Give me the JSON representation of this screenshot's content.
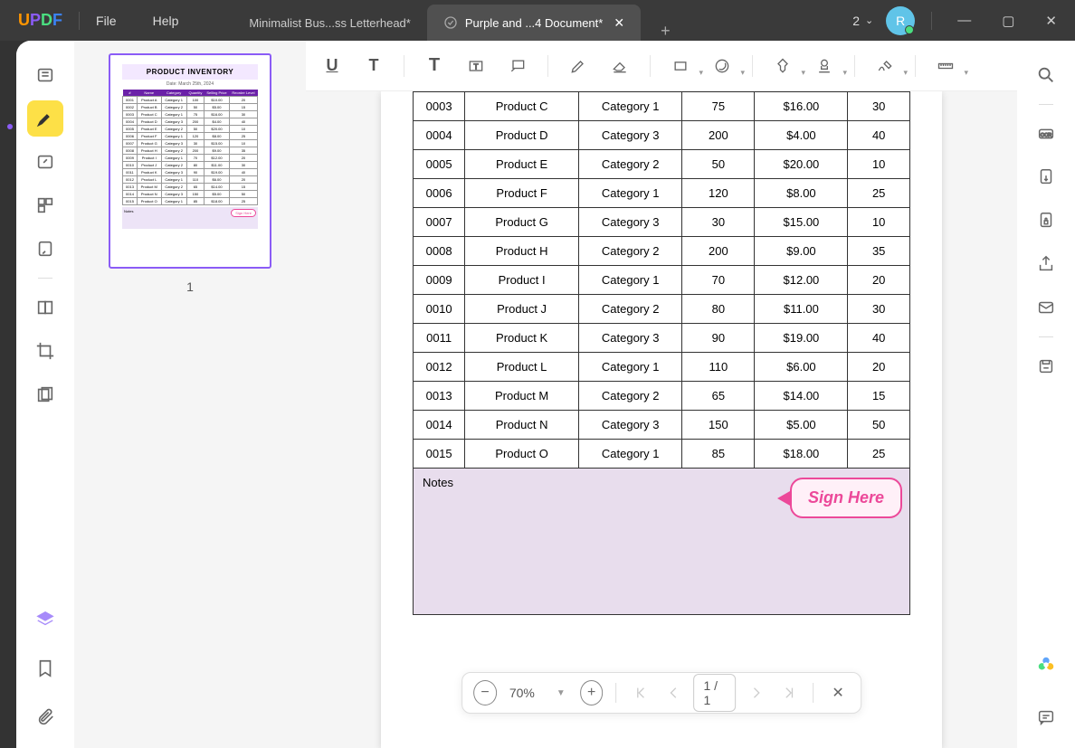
{
  "app": {
    "logo": "UPDF"
  },
  "menus": {
    "file": "File",
    "help": "Help"
  },
  "tabs": [
    {
      "label": "Minimalist Bus...ss Letterhead*",
      "active": false
    },
    {
      "label": "Purple and ...4 Document*",
      "active": true
    }
  ],
  "titlebar": {
    "notif_count": "2",
    "avatar_initial": "R"
  },
  "thumbnail": {
    "title": "PRODUCT INVENTORY",
    "date": "Date: March 25th, 2024",
    "page_number": "1",
    "headers": [
      "#",
      "Name",
      "Category",
      "Quantity",
      "Selling Price",
      "Reorder Level"
    ],
    "rows": [
      [
        "0001",
        "Product A",
        "Category 1",
        "100",
        "$10.00",
        "20"
      ],
      [
        "0002",
        "Product B",
        "Category 2",
        "50",
        "$5.00",
        "15"
      ],
      [
        "0003",
        "Product C",
        "Category 1",
        "75",
        "$16.00",
        "30"
      ],
      [
        "0004",
        "Product D",
        "Category 3",
        "200",
        "$4.00",
        "40"
      ],
      [
        "0005",
        "Product E",
        "Category 2",
        "50",
        "$20.00",
        "10"
      ],
      [
        "0006",
        "Product F",
        "Category 1",
        "120",
        "$8.00",
        "25"
      ],
      [
        "0007",
        "Product G",
        "Category 3",
        "30",
        "$15.00",
        "10"
      ],
      [
        "0008",
        "Product H",
        "Category 2",
        "200",
        "$9.00",
        "35"
      ],
      [
        "0009",
        "Product I",
        "Category 1",
        "70",
        "$12.00",
        "20"
      ],
      [
        "0010",
        "Product J",
        "Category 2",
        "80",
        "$11.00",
        "30"
      ],
      [
        "0011",
        "Product K",
        "Category 3",
        "90",
        "$19.00",
        "40"
      ],
      [
        "0012",
        "Product L",
        "Category 1",
        "110",
        "$6.00",
        "20"
      ],
      [
        "0013",
        "Product M",
        "Category 2",
        "65",
        "$14.00",
        "15"
      ],
      [
        "0014",
        "Product N",
        "Category 3",
        "150",
        "$5.00",
        "50"
      ],
      [
        "0015",
        "Product O",
        "Category 1",
        "85",
        "$18.00",
        "25"
      ]
    ],
    "notes_label": "Notes",
    "sign_label": "Sign Here"
  },
  "document": {
    "visible_rows": [
      [
        "0003",
        "Product C",
        "Category 1",
        "75",
        "$16.00",
        "30"
      ],
      [
        "0004",
        "Product D",
        "Category 3",
        "200",
        "$4.00",
        "40"
      ],
      [
        "0005",
        "Product E",
        "Category 2",
        "50",
        "$20.00",
        "10"
      ],
      [
        "0006",
        "Product F",
        "Category 1",
        "120",
        "$8.00",
        "25"
      ],
      [
        "0007",
        "Product G",
        "Category 3",
        "30",
        "$15.00",
        "10"
      ],
      [
        "0008",
        "Product H",
        "Category 2",
        "200",
        "$9.00",
        "35"
      ],
      [
        "0009",
        "Product I",
        "Category 1",
        "70",
        "$12.00",
        "20"
      ],
      [
        "0010",
        "Product J",
        "Category 2",
        "80",
        "$11.00",
        "30"
      ],
      [
        "0011",
        "Product K",
        "Category 3",
        "90",
        "$19.00",
        "40"
      ],
      [
        "0012",
        "Product L",
        "Category 1",
        "110",
        "$6.00",
        "20"
      ],
      [
        "0013",
        "Product M",
        "Category 2",
        "65",
        "$14.00",
        "15"
      ],
      [
        "0014",
        "Product N",
        "Category 3",
        "150",
        "$5.00",
        "50"
      ],
      [
        "0015",
        "Product O",
        "Category 1",
        "85",
        "$18.00",
        "25"
      ]
    ],
    "notes_label": "Notes",
    "sign_label": "Sign Here"
  },
  "bottombar": {
    "zoom": "70%",
    "page_display": "1  /  1"
  }
}
